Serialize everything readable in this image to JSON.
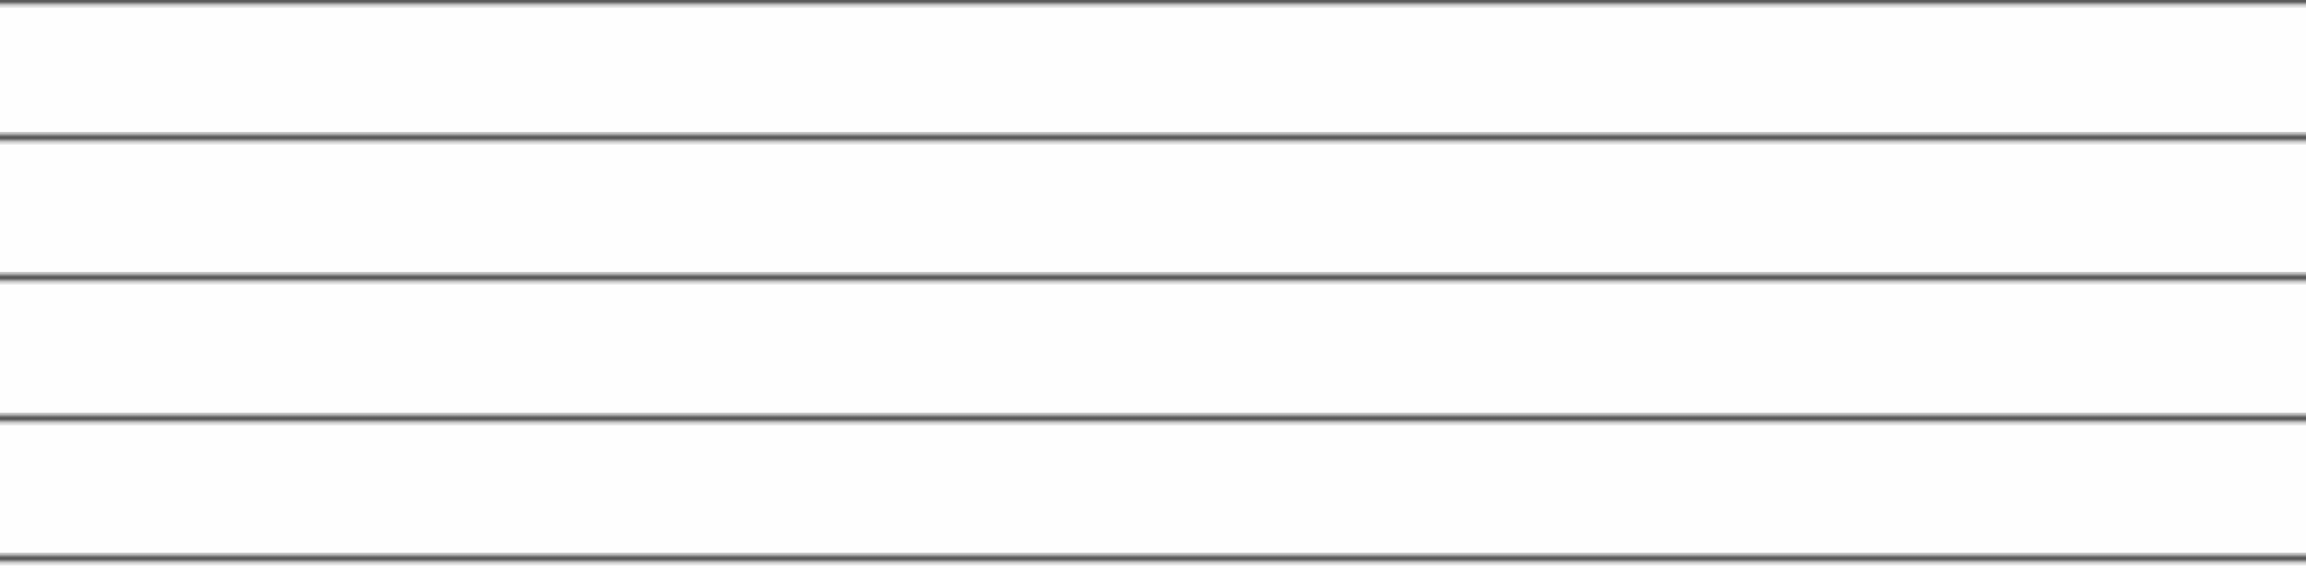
{
  "rules": [
    {
      "id": "rule-1"
    },
    {
      "id": "rule-2"
    },
    {
      "id": "rule-3"
    },
    {
      "id": "rule-4"
    },
    {
      "id": "rule-5"
    }
  ],
  "colors": {
    "background": "#fefefe",
    "rule_dark": "#595959",
    "rule_light": "#cfcfcf"
  }
}
